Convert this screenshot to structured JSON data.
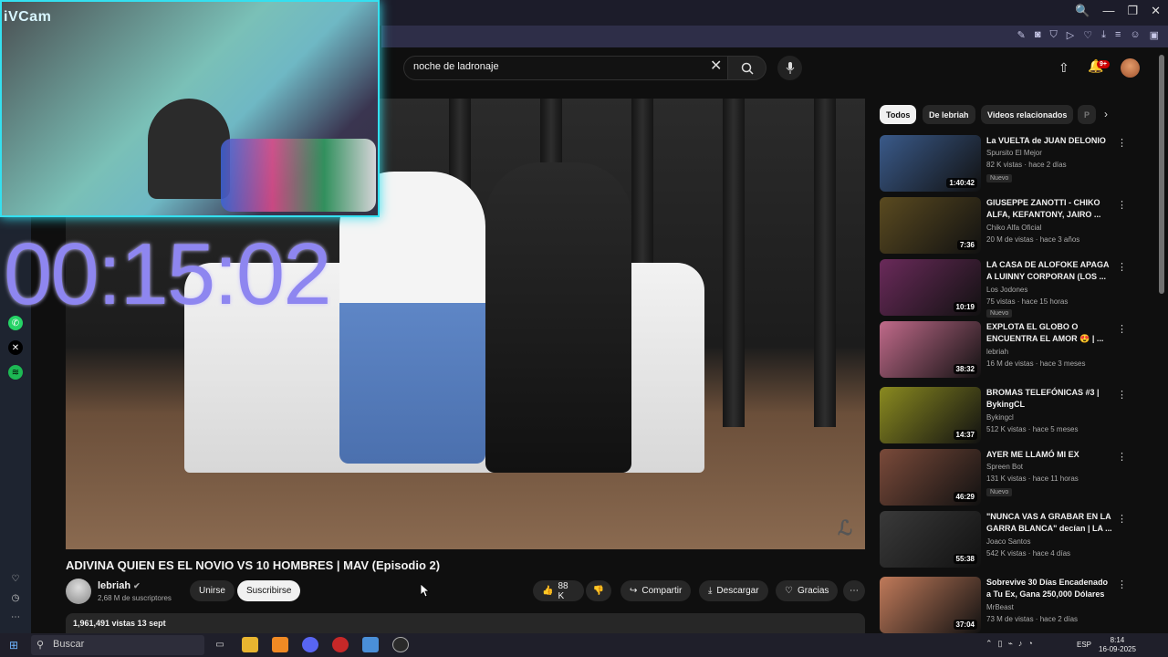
{
  "window": {
    "controls": [
      "🔍",
      "—",
      "❐",
      "✕"
    ]
  },
  "webcam": {
    "label": "iVCam"
  },
  "timer": {
    "text": "00:15:02"
  },
  "search": {
    "value": "noche de ladronaje"
  },
  "notifications": {
    "badge": "9+"
  },
  "video": {
    "title": "ADIVINA QUIEN ES EL NOVIO VS 10 HOMBRES | MAV (Episodio 2)",
    "channel": "lebriah",
    "subscribers": "2,68 M de suscriptores",
    "join_label": "Unirse",
    "subscribe_label": "Suscribirse",
    "likes": "88 K",
    "share_label": "Compartir",
    "download_label": "Descargar",
    "thanks_label": "Gracias",
    "views_date": "1,961,491 vistas  13 sept"
  },
  "chips": [
    "Todos",
    "De lebriah",
    "Videos relacionados",
    "P"
  ],
  "recommendations": [
    {
      "title": "La VUELTA de JUAN DELONIO",
      "channel": "Spursito El Mejor",
      "stats": "82 K vistas · hace 2 días",
      "duration": "1:40:42",
      "badge": "Nuevo",
      "thumb": "#3a5a8a"
    },
    {
      "title": "GIUSEPPE ZANOTTI - CHIKO ALFA, KEFANTONY, JAIRO ...",
      "channel": "Chiko Alfa Oficial",
      "stats": "20 M de vistas · hace 3 años",
      "duration": "7:36",
      "badge": "",
      "thumb": "#5a4a20"
    },
    {
      "title": "LA CASA DE ALOFOKE APAGA A LUINNY CORPORAN (LOS ...",
      "channel": "Los Jodones",
      "stats": "75 vistas · hace 15 horas",
      "duration": "10:19",
      "badge": "Nuevo",
      "thumb": "#6a2a5a"
    },
    {
      "title": "EXPLOTA EL GLOBO O ENCUENTRA EL AMOR 😍 | ...",
      "channel": "lebriah",
      "stats": "16 M de vistas · hace 3 meses",
      "duration": "38:32",
      "badge": "",
      "thumb": "#c06a8a"
    },
    {
      "title": "BROMAS TELEFÓNICAS #3 | BykingCL",
      "channel": "Bykingcl",
      "stats": "512 K vistas · hace 5 meses",
      "duration": "14:37",
      "badge": "",
      "thumb": "#8a8a20"
    },
    {
      "title": "AYER ME LLAMÓ MI EX",
      "channel": "Spreen Bot",
      "stats": "131 K vistas · hace 11 horas",
      "duration": "46:29",
      "badge": "Nuevo",
      "thumb": "#7a4a3a"
    },
    {
      "title": "\"NUNCA VAS A GRABAR EN LA GARRA BLANCA\" decían | LA ...",
      "channel": "Joaco Santos",
      "stats": "542 K vistas · hace 4 días",
      "duration": "55:38",
      "badge": "",
      "thumb": "#3a3a3a"
    },
    {
      "title": "Sobrevive 30 Días Encadenado a Tu Ex, Gana 250,000 Dólares",
      "channel": "MrBeast",
      "stats": "73 M de vistas · hace 2 días",
      "duration": "37:04",
      "badge": "",
      "thumb": "#c07a5a"
    }
  ],
  "taskbar": {
    "search_placeholder": "Buscar",
    "lang": "ESP",
    "time": "8:14",
    "date": "16-09-2025"
  }
}
